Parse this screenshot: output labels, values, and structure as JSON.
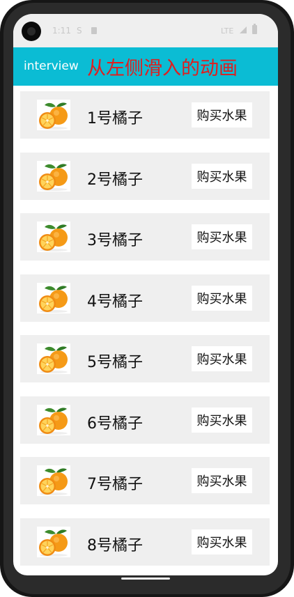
{
  "status_bar": {
    "time": "1:11",
    "notification": "S",
    "network": "LTE",
    "icons": [
      "sd-card-icon",
      "signal-icon",
      "battery-icon"
    ]
  },
  "app_bar": {
    "app_name": "interview",
    "title": "从左侧滑入的动画",
    "background_color": "#0bbcd4",
    "title_color": "#e01e1e"
  },
  "items": [
    {
      "name": "1号橘子",
      "button": "购买水果",
      "icon": "orange-fruit-icon"
    },
    {
      "name": "2号橘子",
      "button": "购买水果",
      "icon": "orange-fruit-icon"
    },
    {
      "name": "3号橘子",
      "button": "购买水果",
      "icon": "orange-fruit-icon"
    },
    {
      "name": "4号橘子",
      "button": "购买水果",
      "icon": "orange-fruit-icon"
    },
    {
      "name": "5号橘子",
      "button": "购买水果",
      "icon": "orange-fruit-icon"
    },
    {
      "name": "6号橘子",
      "button": "购买水果",
      "icon": "orange-fruit-icon"
    },
    {
      "name": "7号橘子",
      "button": "购买水果",
      "icon": "orange-fruit-icon"
    },
    {
      "name": "8号橘子",
      "button": "购买水果",
      "icon": "orange-fruit-icon"
    }
  ]
}
